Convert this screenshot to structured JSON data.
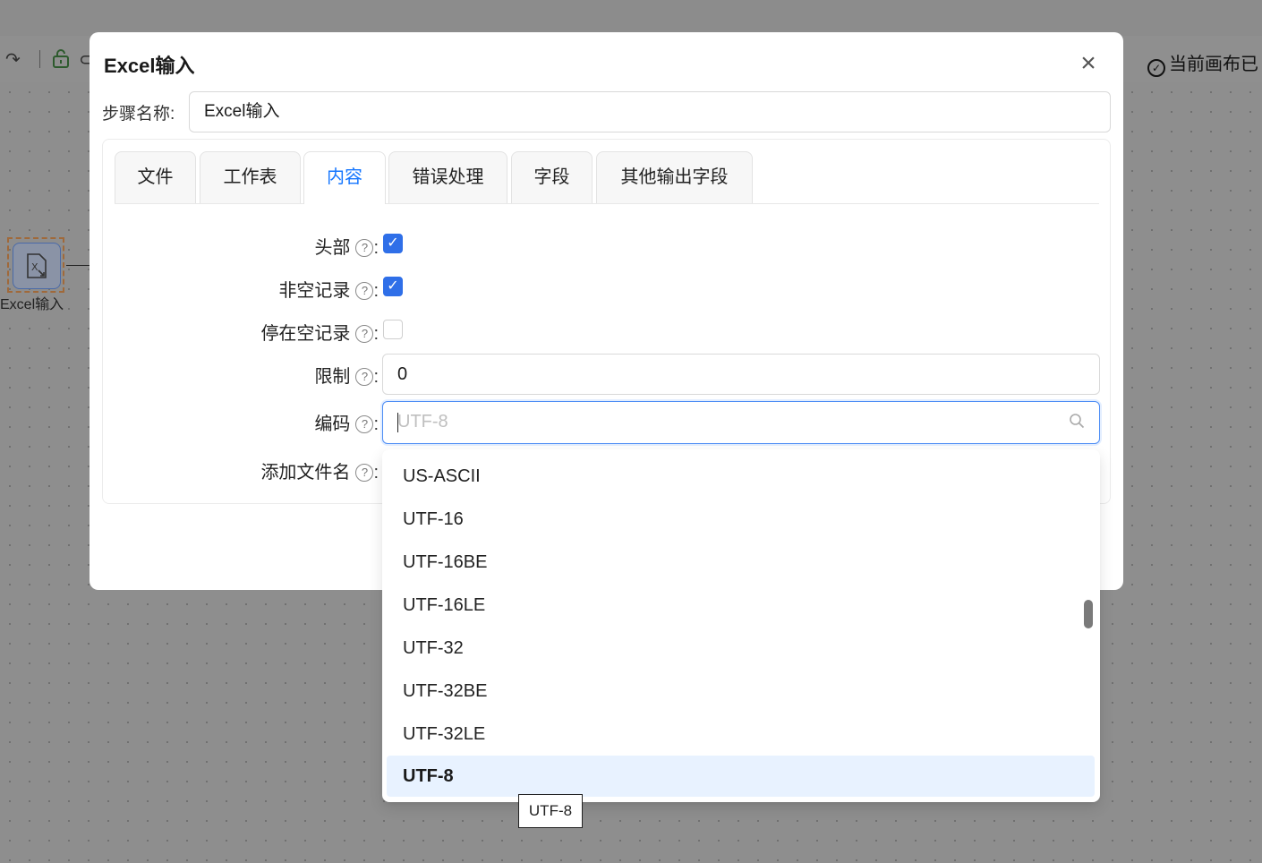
{
  "canvas": {
    "node_label": "Excel输入",
    "node_icon": "excel-file-icon",
    "status_text": "当前画布已",
    "status_icon": "check-circle-icon",
    "toolbar_icons": [
      "redo-icon",
      "unlock-icon",
      "link-icon"
    ]
  },
  "modal": {
    "title": "Excel输入",
    "close_icon": "close-icon",
    "step_name_label": "步骤名称:",
    "step_name_value": "Excel输入",
    "tabs": [
      {
        "label": "文件"
      },
      {
        "label": "工作表"
      },
      {
        "label": "内容"
      },
      {
        "label": "错误处理"
      },
      {
        "label": "字段"
      },
      {
        "label": "其他输出字段"
      }
    ],
    "active_tab": "内容",
    "fields": {
      "header": {
        "label": "头部",
        "checked": true
      },
      "non_empty": {
        "label": "非空记录",
        "checked": true
      },
      "stop_empty": {
        "label": "停在空记录",
        "checked": false
      },
      "limit": {
        "label": "限制",
        "value": "0"
      },
      "encoding": {
        "label": "编码",
        "placeholder": "UTF-8"
      },
      "add_filename": {
        "label": "添加文件名"
      }
    },
    "colon": ":",
    "help_icon": "question-circle-icon"
  },
  "dropdown": {
    "options": [
      "US-ASCII",
      "UTF-16",
      "UTF-16BE",
      "UTF-16LE",
      "UTF-32",
      "UTF-32BE",
      "UTF-32LE",
      "UTF-8"
    ],
    "selected": "UTF-8"
  },
  "tooltip": {
    "text": "UTF-8"
  },
  "colors": {
    "accent": "#1677ff",
    "checkbox": "#2f6fe8",
    "selected_bg": "#e8f2ff"
  }
}
